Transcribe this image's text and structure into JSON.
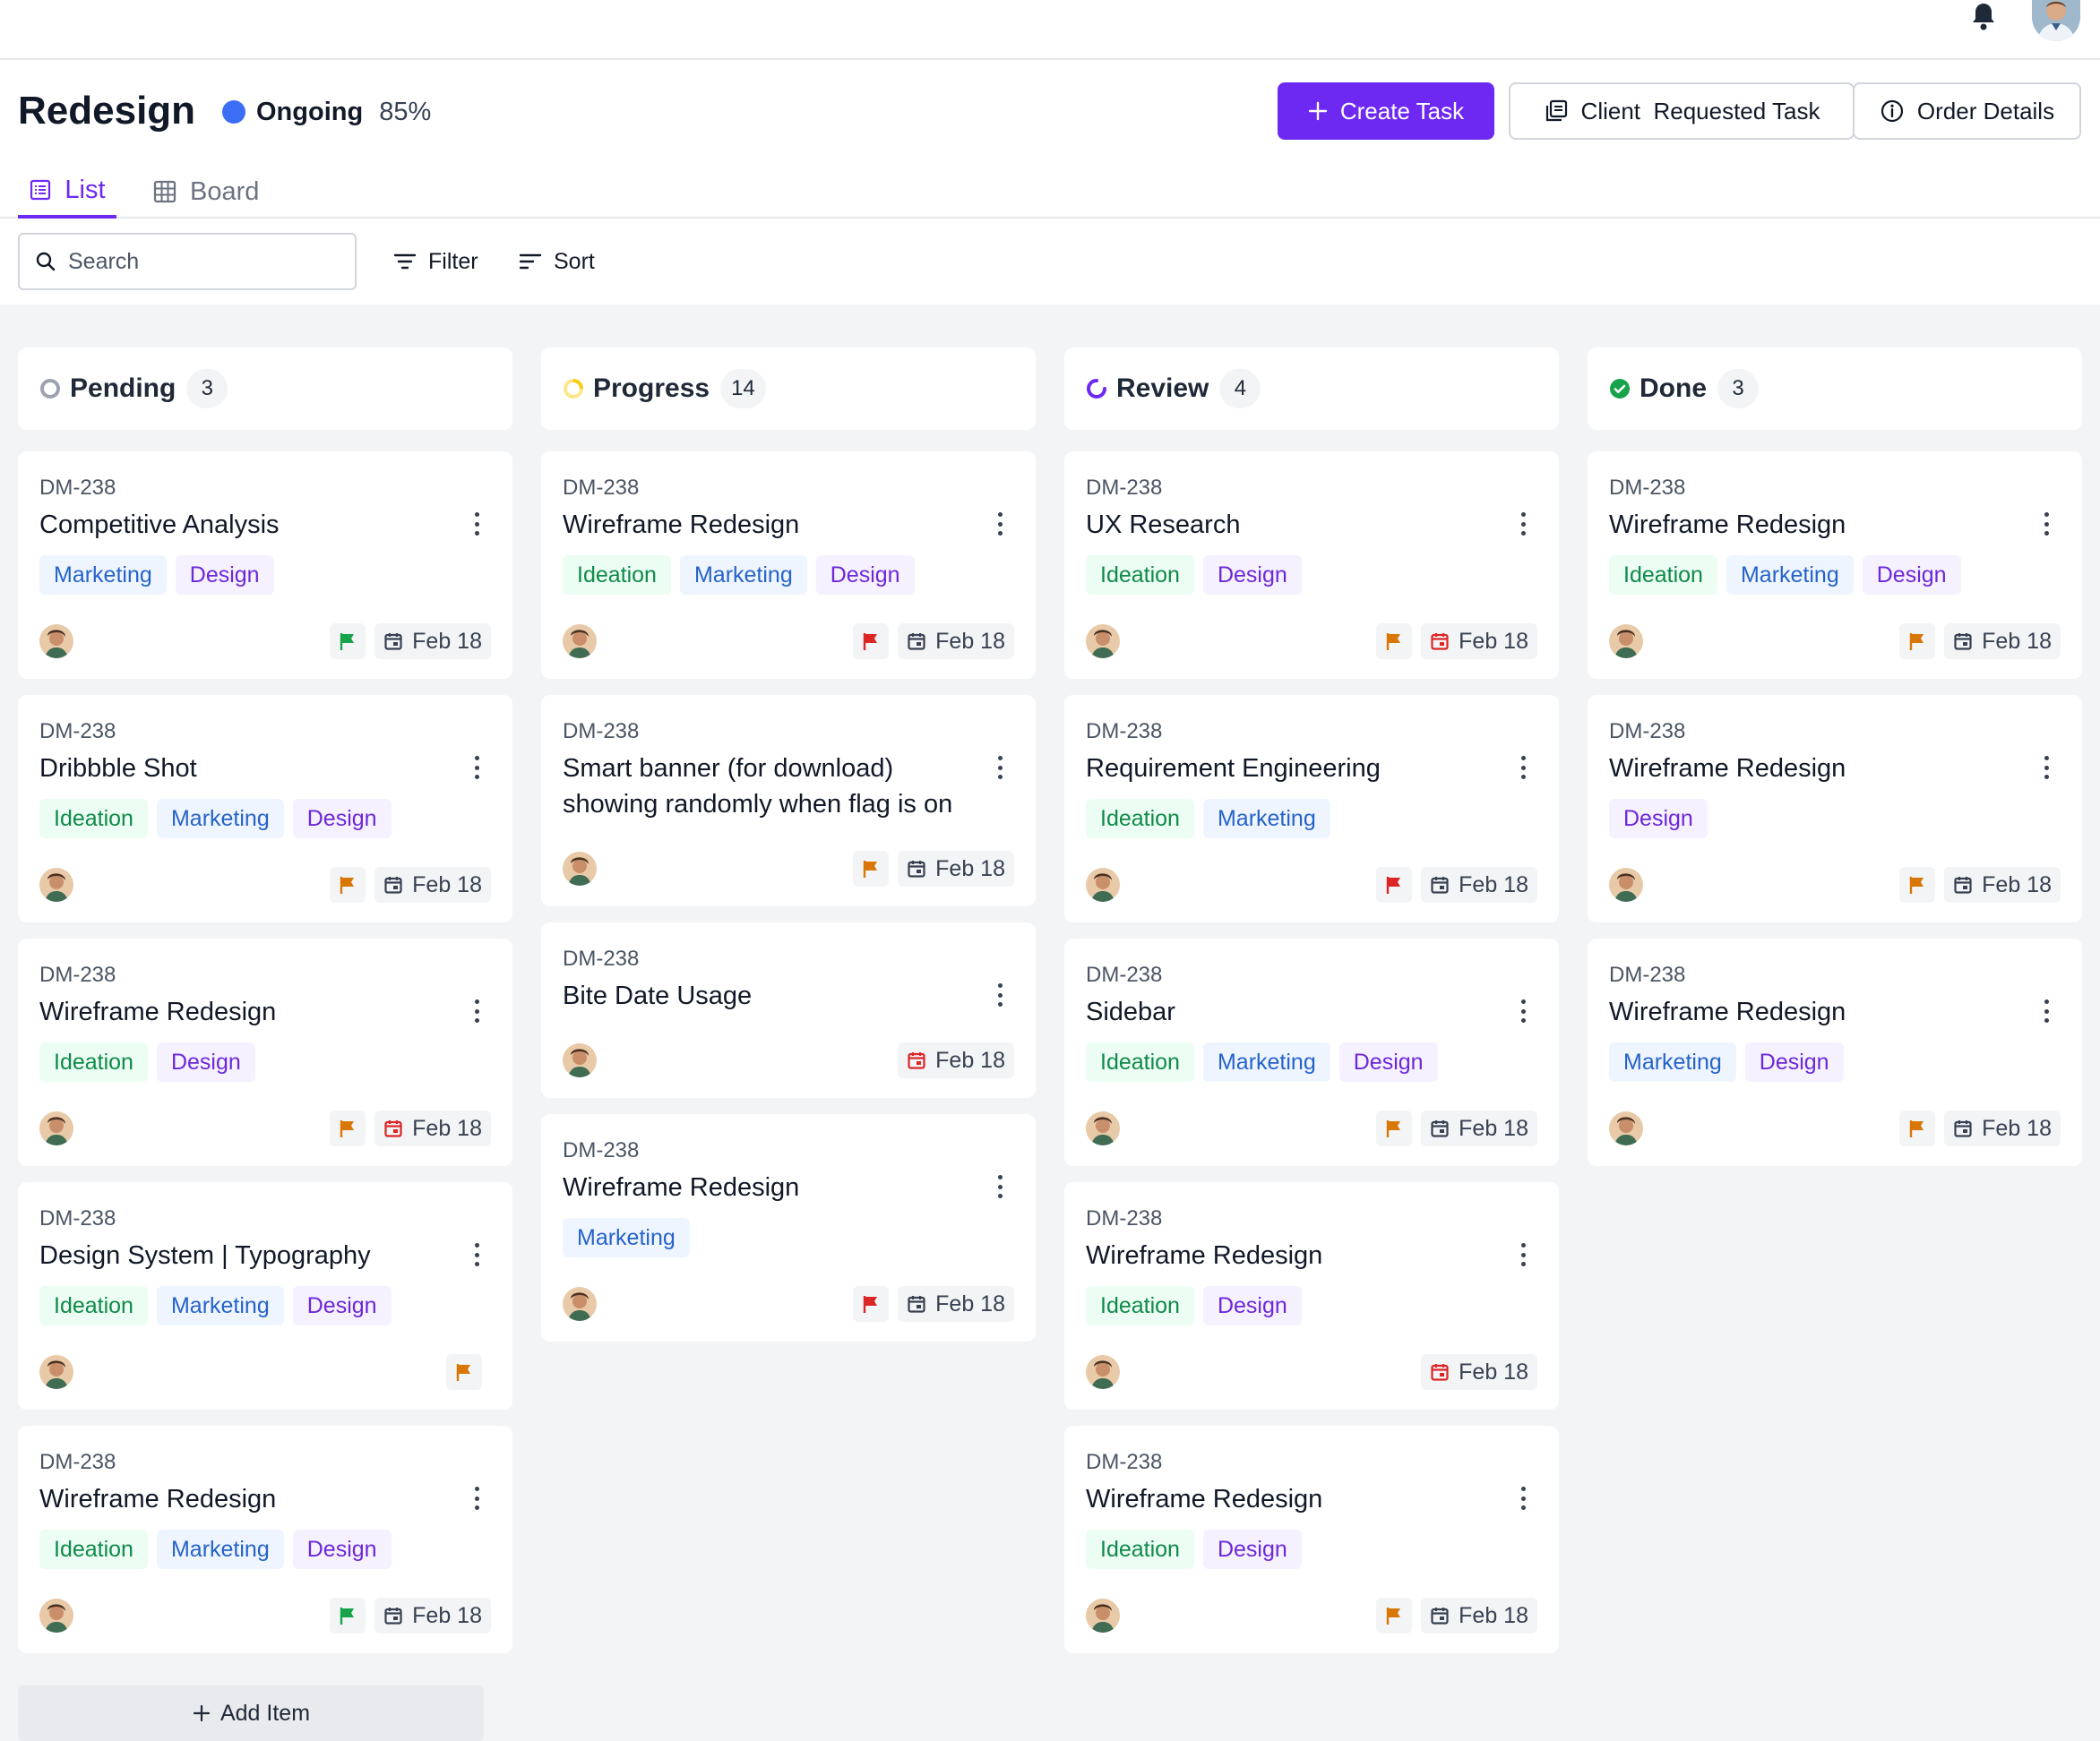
{
  "project": {
    "title": "Redesign",
    "status_label": "Ongoing",
    "progress": "85%",
    "status_color": "#3b6ef5"
  },
  "actions": {
    "create_task": "Create Task",
    "client_requested": "Client  Requested Task",
    "order_details": "Order Details"
  },
  "view_tabs": {
    "list": "List",
    "board": "Board",
    "active": "List"
  },
  "toolbar": {
    "search_placeholder": "Search",
    "filter": "Filter",
    "sort": "Sort"
  },
  "colors": {
    "accent": "#6d28f2",
    "flag_green": "#16a34a",
    "flag_orange": "#d97706",
    "flag_red": "#dc2626",
    "date_red": "#dc2626"
  },
  "columns": [
    {
      "key": "pending",
      "title": "Pending",
      "count": "3",
      "icon": "pending-circle-icon",
      "cards": [
        {
          "id": "DM-238",
          "title": "Competitive Analysis",
          "tags": [
            "Marketing",
            "Design"
          ],
          "flag": "green",
          "date": "Feb 18",
          "date_alert": false
        },
        {
          "id": "DM-238",
          "title": "Dribbble Shot",
          "tags": [
            "Ideation",
            "Marketing",
            "Design"
          ],
          "flag": "orange",
          "date": "Feb 18",
          "date_alert": false
        },
        {
          "id": "DM-238",
          "title": "Wireframe Redesign",
          "tags": [
            "Ideation",
            "Design"
          ],
          "flag": "orange",
          "date": "Feb 18",
          "date_alert": true
        },
        {
          "id": "DM-238",
          "title": "Design System | Typography",
          "tags": [
            "Ideation",
            "Marketing",
            "Design"
          ],
          "flag": "orange",
          "date": null,
          "date_alert": false
        },
        {
          "id": "DM-238",
          "title": "Wireframe Redesign",
          "tags": [
            "Ideation",
            "Marketing",
            "Design"
          ],
          "flag": "green",
          "date": "Feb 18",
          "date_alert": false
        }
      ]
    },
    {
      "key": "progress",
      "title": "Progress",
      "count": "14",
      "icon": "progress-spinner-icon",
      "cards": [
        {
          "id": "DM-238",
          "title": "Wireframe Redesign",
          "tags": [
            "Ideation",
            "Marketing",
            "Design"
          ],
          "flag": "red",
          "date": "Feb 18",
          "date_alert": false
        },
        {
          "id": "DM-238",
          "title": "Smart banner (for download) showing randomly when flag is on",
          "tags": [],
          "flag": "orange",
          "date": "Feb 18",
          "date_alert": false
        },
        {
          "id": "DM-238",
          "title": "Bite Date Usage",
          "tags": [],
          "flag": null,
          "date": "Feb 18",
          "date_alert": true
        },
        {
          "id": "DM-238",
          "title": "Wireframe Redesign",
          "tags": [
            "Marketing"
          ],
          "flag": "red",
          "date": "Feb 18",
          "date_alert": false
        }
      ]
    },
    {
      "key": "review",
      "title": "Review",
      "count": "4",
      "icon": "review-spinner-icon",
      "cards": [
        {
          "id": "DM-238",
          "title": "UX Research",
          "tags": [
            "Ideation",
            "Design"
          ],
          "flag": "orange",
          "date": "Feb 18",
          "date_alert": true
        },
        {
          "id": "DM-238",
          "title": "Requirement Engineering",
          "tags": [
            "Ideation",
            "Marketing"
          ],
          "flag": "red",
          "date": "Feb 18",
          "date_alert": false
        },
        {
          "id": "DM-238",
          "title": "Sidebar",
          "tags": [
            "Ideation",
            "Marketing",
            "Design"
          ],
          "flag": "orange",
          "date": "Feb 18",
          "date_alert": false
        },
        {
          "id": "DM-238",
          "title": "Wireframe Redesign",
          "tags": [
            "Ideation",
            "Design"
          ],
          "flag": null,
          "date": "Feb 18",
          "date_alert": true
        },
        {
          "id": "DM-238",
          "title": "Wireframe Redesign",
          "tags": [
            "Ideation",
            "Design"
          ],
          "flag": "orange",
          "date": "Feb 18",
          "date_alert": false
        }
      ]
    },
    {
      "key": "done",
      "title": "Done",
      "count": "3",
      "icon": "done-check-icon",
      "cards": [
        {
          "id": "DM-238",
          "title": "Wireframe Redesign",
          "tags": [
            "Ideation",
            "Marketing",
            "Design"
          ],
          "flag": "orange",
          "date": "Feb 18",
          "date_alert": false
        },
        {
          "id": "DM-238",
          "title": "Wireframe Redesign",
          "tags": [
            "Design"
          ],
          "flag": "orange",
          "date": "Feb 18",
          "date_alert": false
        },
        {
          "id": "DM-238",
          "title": "Wireframe Redesign",
          "tags": [
            "Marketing",
            "Design"
          ],
          "flag": "orange",
          "date": "Feb 18",
          "date_alert": false
        }
      ]
    }
  ],
  "add_item": "Add Item"
}
